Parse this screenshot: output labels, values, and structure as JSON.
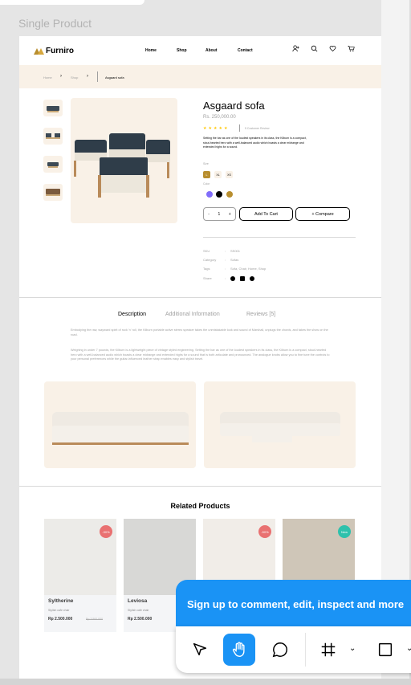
{
  "canvas": {
    "frame_label": "Single Product"
  },
  "header": {
    "brand": "Furniro",
    "nav": [
      "Home",
      "Shop",
      "About",
      "Contact"
    ],
    "icons": [
      "user-add-icon",
      "search-icon",
      "heart-icon",
      "cart-icon"
    ]
  },
  "breadcrumb": {
    "home": "Home",
    "shop": "Shop",
    "current": "Asgaard sofa"
  },
  "product": {
    "title": "Asgaard sofa",
    "price": "Rs. 250,000.00",
    "rating_stars": 4.5,
    "reviews": "5 Customer Review",
    "description": "Setting the bar as one of the loudest speakers in its class, the Kilburn is a compact, stout-hearted hero with a well-balanced audio which boasts a clear midrange and extended highs for a sound.",
    "size_label": "Size",
    "sizes": [
      "L",
      "XL",
      "XS"
    ],
    "color_label": "Color",
    "colors": [
      "#816dfa",
      "#000000",
      "#b88e2f"
    ],
    "quantity": "1",
    "qty_minus": "-",
    "qty_plus": "+",
    "add_to_cart": "Add To Cart",
    "compare": "+ Compare",
    "meta": {
      "sku_label": "SKU",
      "sku": "SS001",
      "category_label": "Category",
      "category": "Sofas",
      "tags_label": "Tags",
      "tags": "Sofa, Chair, Home, Shop",
      "share_label": "Share",
      "sep": ":"
    }
  },
  "tabs": {
    "description": "Description",
    "additional": "Additional Information",
    "reviews": "Reviews [5]",
    "para1": "Embodying the raw, wayward spirit of rock 'n' roll, the Kilburn portable active stereo speaker takes the unmistakable look and sound of Marshall, unplugs the chords, and takes the show on the road.",
    "para2": "Weighing in under 7 pounds, the Kilburn is a lightweight piece of vintage styled engineering. Setting the bar as one of the loudest speakers in its class, the Kilburn is a compact, stout-hearted hero with a well-balanced audio which boasts a clear midrange and extended highs for a sound that is both articulate and pronounced. The analogue knobs allow you to fine tune the controls to your personal preferences while the guitar-influenced leather strap enables easy and stylish travel."
  },
  "related": {
    "title": "Related Products",
    "items": [
      {
        "name": "Syltherine",
        "sub": "Stylish cafe chair",
        "price": "Rp 2.500.000",
        "old": "Rp 3.500.000",
        "badge": "-30%",
        "badge_color": "#e97171"
      },
      {
        "name": "Leviosa",
        "sub": "Stylish cafe chair",
        "price": "Rp 2.500.000",
        "old": "",
        "badge": "",
        "badge_color": ""
      },
      {
        "name": "",
        "sub": "",
        "price": "",
        "old": "",
        "badge": "-50%",
        "badge_color": "#e97171"
      },
      {
        "name": "",
        "sub": "",
        "price": "",
        "old": "",
        "badge": "New",
        "badge_color": "#2ec1ac"
      }
    ]
  },
  "overlay": {
    "signup": "Sign up to comment, edit, inspect and more",
    "tools": [
      "move-tool",
      "hand-tool",
      "comment-tool",
      "frame-tool",
      "shape-tool"
    ]
  }
}
